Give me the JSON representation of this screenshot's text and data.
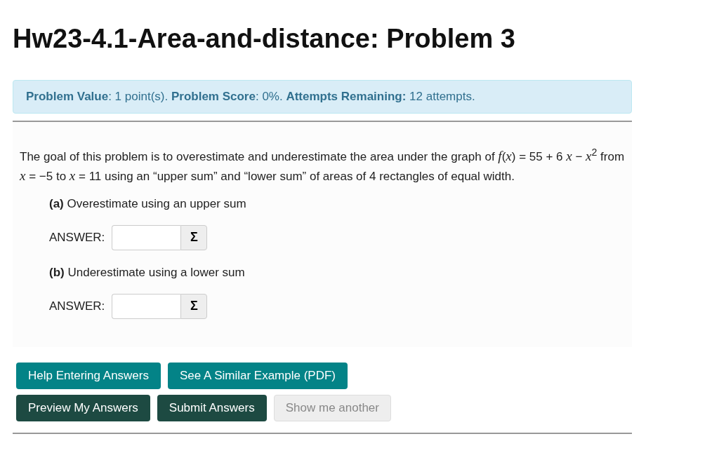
{
  "title": "Hw23-4.1-Area-and-distance: Problem 3",
  "info": "**Problem Value**: 1 point(s). **Problem Score**: 0%. **Attempts Remaining:** 12 attempts.",
  "problem_text": "The goal of this problem is to overestimate and underestimate the area under the graph of *f*(*x*) = 55 + 6 *x* − *x*$^{2}$ from *x* = −5 to *x* = 11 using an “upper sum” and “lower sum” of areas of 4 rectangles of equal width.",
  "parts": [
    {
      "prompt": "**(a)** Overestimate using an upper sum",
      "answer_label": "ANSWER:",
      "equation_button": "Σ"
    },
    {
      "prompt": "**(b)** Underestimate using a lower sum",
      "answer_label": "ANSWER:",
      "equation_button": "Σ"
    }
  ],
  "button_rows": [
    [
      {
        "label": "Help Entering Answers",
        "kind": "help",
        "disabled": false
      },
      {
        "label": "See A Similar Example (PDF)",
        "kind": "help",
        "disabled": false
      }
    ],
    [
      {
        "label": "Preview My Answers",
        "kind": "action",
        "disabled": false
      },
      {
        "label": "Submit Answers",
        "kind": "action",
        "disabled": false
      },
      {
        "label": "Show me another",
        "kind": "action",
        "disabled": true
      }
    ]
  ]
}
